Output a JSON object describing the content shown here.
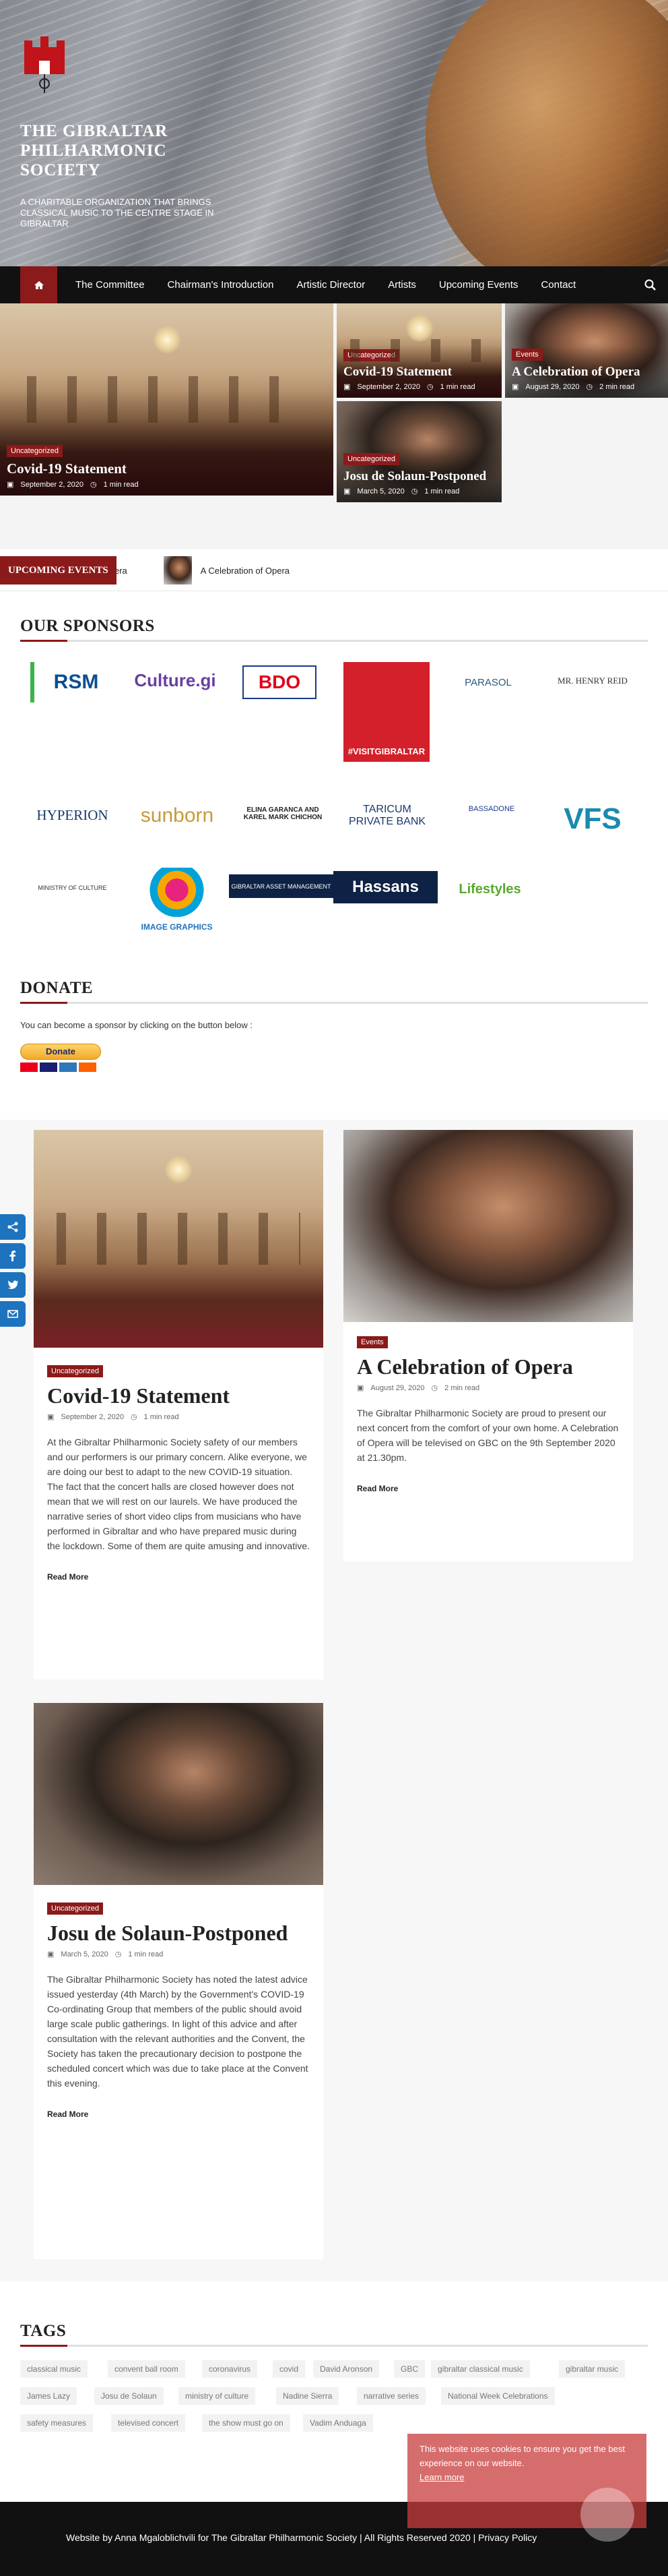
{
  "site": {
    "title": "THE GIBRALTAR PHILHARMONIC SOCIETY",
    "tagline": "A CHARITABLE ORGANIZATION THAT BRINGS CLASSICAL MUSIC TO THE CENTRE STAGE IN GIBRALTAR"
  },
  "nav": {
    "items": [
      "The Committee",
      "Chairman's Introduction",
      "Artistic Director",
      "Artists",
      "Upcoming Events",
      "Contact"
    ]
  },
  "featured": [
    {
      "category": "Uncategorized",
      "title": "Covid-19 Statement",
      "date": "September 2, 2020",
      "read": "1 min read"
    },
    {
      "category": "Uncategorized",
      "title": "Covid-19 Statement",
      "date": "September 2, 2020",
      "read": "1 min read"
    },
    {
      "category": "Events",
      "title": "A Celebration of Opera",
      "date": "August 29, 2020",
      "read": "2 min read"
    },
    {
      "category": "Uncategorized",
      "title": "Josu de Solaun-Postponed",
      "date": "March 5, 2020",
      "read": "1 min read"
    }
  ],
  "ticker": {
    "label": "UPCOMING EVENTS",
    "item_a": "pera",
    "item_b": "A Celebration of Opera"
  },
  "sponsors_title": "OUR SPONSORS",
  "sponsors": [
    {
      "text": "RSM"
    },
    {
      "text": "Culture.gi"
    },
    {
      "text": "BDO"
    },
    {
      "text": "#VISITGIBRALTAR"
    },
    {
      "text": "PARASOL"
    },
    {
      "text": "MR. HENRY REID"
    },
    {
      "text": "HYPERION"
    },
    {
      "text": "sunborn"
    },
    {
      "text": "ELINA GARANCA AND KAREL MARK CHICHON"
    },
    {
      "text": "TARICUM PRIVATE BANK"
    },
    {
      "text": "BASSADONE"
    },
    {
      "text": "VFS"
    },
    {
      "text": "MINISTRY OF CULTURE"
    },
    {
      "text": "IMAGE GRAPHICS"
    },
    {
      "text": "GIBRALTAR ASSET MANAGEMENT"
    },
    {
      "text": "Hassans"
    },
    {
      "text": "Lifestyles"
    }
  ],
  "donate": {
    "title": "DONATE",
    "text": "You can become a sponsor by clicking on the button below :",
    "button": "Donate"
  },
  "posts": [
    {
      "category": "Uncategorized",
      "title": "Covid-19 Statement",
      "date": "September 2, 2020",
      "read": "1 min read",
      "excerpt": "At the Gibraltar Philharmonic Society safety of our members and our performers is our primary concern. Alike everyone, we are doing our best to adapt to the new COVID-19 situation. The fact that the concert halls are closed however does not mean that we will rest on our laurels. We have produced the narrative series of short video clips from musicians who have performed in Gibraltar and who have prepared music during the lockdown. Some of them are quite amusing and innovative.",
      "more": "Read More"
    },
    {
      "category": "Events",
      "title": "A Celebration of Opera",
      "date": "August 29, 2020",
      "read": "2 min read",
      "excerpt": "The Gibraltar Philharmonic Society are proud to present our next concert from the comfort of your own home. A Celebration of Opera will be televised on GBC on the 9th September 2020 at 21.30pm.",
      "more": "Read More"
    },
    {
      "category": "Uncategorized",
      "title": "Josu de Solaun-Postponed",
      "date": "March 5, 2020",
      "read": "1 min read",
      "excerpt": "The Gibraltar Philharmonic Society has noted the latest advice issued yesterday (4th March) by the Government's COVID-19 Co-ordinating Group that members of the public should avoid large scale public gatherings. In light of this advice and after consultation with the relevant authorities and the Convent, the Society has taken the precautionary decision to postpone the scheduled concert which was due to take place at the Convent this evening.",
      "more": "Read More"
    }
  ],
  "tags_title": "TAGS",
  "tags": [
    "classical music",
    "convent ball room",
    "coronavirus",
    "covid",
    "David Aronson",
    "GBC",
    "gibraltar classical music",
    "gibraltar music",
    "James Lazy",
    "Josu de Solaun",
    "ministry of culture",
    "Nadine Sierra",
    "narrative series",
    "National Week Celebrations",
    "safety measures",
    "televised concert",
    "the show must go on",
    "Vadim Anduaga"
  ],
  "cookie": {
    "text": "This website uses cookies to ensure you get the best experience on our website.",
    "link": "Learn more"
  },
  "footer": {
    "text": "Website by Anna Mgaloblichvili for The Gibraltar Philharmonic Society | All Rights Reserved 2020 | Privacy Policy"
  },
  "colors": {
    "accent": "#8b1a1a",
    "nav_bg": "#111111",
    "social": "#1e73be"
  }
}
